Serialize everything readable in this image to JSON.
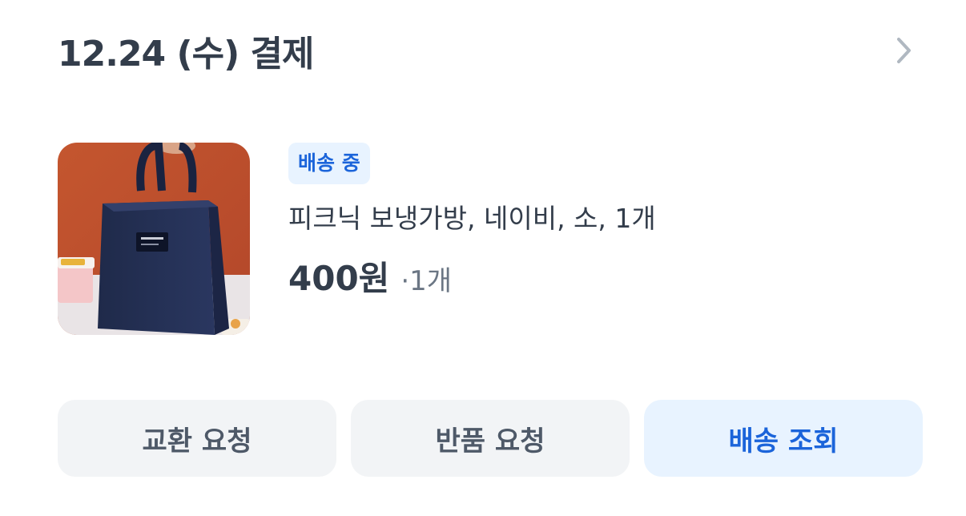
{
  "order": {
    "title": "12.24 (수) 결제"
  },
  "product": {
    "status": "배송 중",
    "name": "피크닉 보냉가방, 네이비, 소, 1개",
    "price": "400원",
    "quantity": "·1개",
    "image_icon": "navy-cooler-bag-photo"
  },
  "actions": {
    "exchange_label": "교환 요청",
    "return_label": "반품 요청",
    "track_label": "배송 조회"
  },
  "colors": {
    "text_primary": "#333d4b",
    "text_secondary": "#6b7684",
    "accent": "#1b64da",
    "accent_bg": "#e8f3ff",
    "button_bg": "#f2f4f6"
  }
}
